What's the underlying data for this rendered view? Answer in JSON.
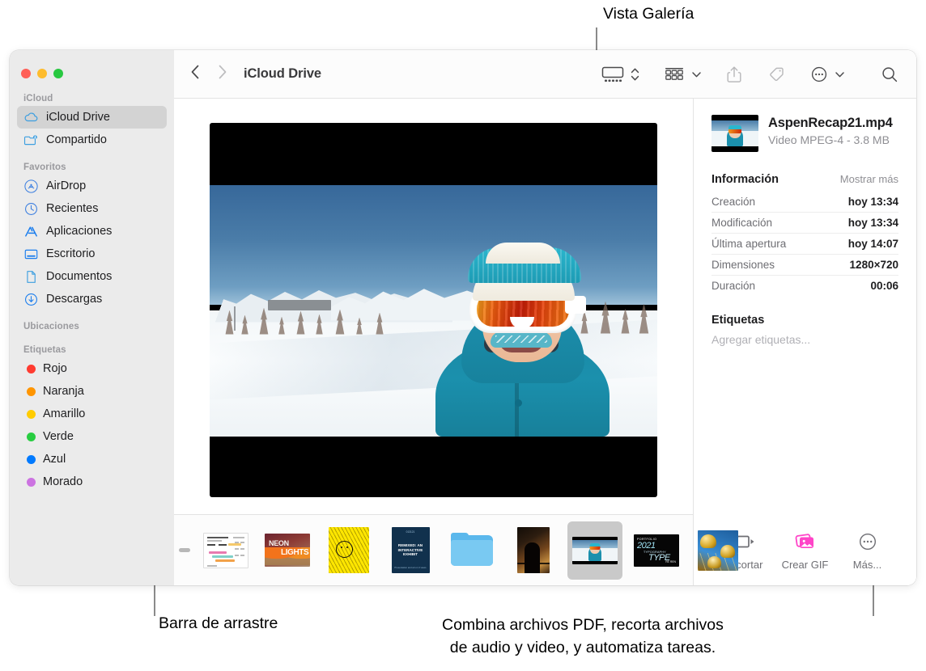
{
  "window": {
    "traffic_lights": [
      {
        "name": "close",
        "color": "#ff5f57"
      },
      {
        "name": "minimize",
        "color": "#febc2e"
      },
      {
        "name": "zoom",
        "color": "#28c840"
      }
    ]
  },
  "toolbar": {
    "back_label": "‹",
    "forward_label": "›",
    "path_title": "iCloud Drive",
    "buttons": [
      {
        "name": "gallery-view",
        "icon": "gallery-view-icon"
      },
      {
        "name": "view-options-stepper",
        "icon": "chevron-updown-icon"
      },
      {
        "name": "group-by",
        "icon": "grid-group-icon"
      },
      {
        "name": "group-by-chevron",
        "icon": "chevron-down-icon"
      },
      {
        "name": "share",
        "icon": "share-icon"
      },
      {
        "name": "tags",
        "icon": "tag-icon"
      },
      {
        "name": "more-actions",
        "icon": "ellipsis-circle-icon"
      },
      {
        "name": "more-actions-chevron",
        "icon": "chevron-down-icon"
      },
      {
        "name": "search",
        "icon": "search-icon"
      }
    ]
  },
  "sidebar": {
    "groups": [
      {
        "title": "iCloud",
        "items": [
          {
            "label": "iCloud Drive",
            "icon": "cloud-icon",
            "selected": true
          },
          {
            "label": "Compartido",
            "icon": "shared-folder-icon",
            "selected": false
          }
        ]
      },
      {
        "title": "Favoritos",
        "items": [
          {
            "label": "AirDrop",
            "icon": "airdrop-icon",
            "selected": false
          },
          {
            "label": "Recientes",
            "icon": "clock-icon",
            "selected": false
          },
          {
            "label": "Aplicaciones",
            "icon": "applications-icon",
            "selected": false
          },
          {
            "label": "Escritorio",
            "icon": "desktop-icon",
            "selected": false
          },
          {
            "label": "Documentos",
            "icon": "document-icon",
            "selected": false
          },
          {
            "label": "Descargas",
            "icon": "downloads-icon",
            "selected": false
          }
        ]
      },
      {
        "title": "Ubicaciones",
        "items": []
      },
      {
        "title": "Etiquetas",
        "items": [
          {
            "label": "Rojo",
            "color": "#ff3b30",
            "selected": false
          },
          {
            "label": "Naranja",
            "color": "#ff9500",
            "selected": false
          },
          {
            "label": "Amarillo",
            "color": "#ffcc00",
            "selected": false
          },
          {
            "label": "Verde",
            "color": "#28cd41",
            "selected": false
          },
          {
            "label": "Azul",
            "color": "#007aff",
            "selected": false
          },
          {
            "label": "Morado",
            "color": "#cc73e1",
            "selected": false
          }
        ]
      }
    ]
  },
  "preview": {
    "name": "video-preview",
    "description": "Snowboarder with white goggles and teal beanie in snowy mountains, letterboxed video"
  },
  "filmstrip": {
    "drag_bar_label": "drag-bar",
    "thumbnails": [
      {
        "name": "thumb-chart-document",
        "type": "document",
        "selected": false
      },
      {
        "name": "thumb-neon-lights-poster",
        "type": "poster",
        "text1": "NEON",
        "text2": "LIGHTS",
        "selected": false
      },
      {
        "name": "thumb-thank-you-poster",
        "type": "poster",
        "selected": false
      },
      {
        "name": "thumb-exhibit-poster",
        "type": "poster",
        "title": "013121",
        "body": "REMIXED:\nAN INTERACTIVE\nEXHIBIT",
        "footer": "Presentation and art on 3 views",
        "selected": false
      },
      {
        "name": "thumb-folder",
        "type": "folder",
        "selected": false
      },
      {
        "name": "thumb-silhouette-photo",
        "type": "photo",
        "selected": false
      },
      {
        "name": "thumb-aspen-recap-video",
        "type": "video",
        "selected": true
      },
      {
        "name": "thumb-typography-poster",
        "type": "poster",
        "p1": "PORTFOLIO",
        "p2": "2021",
        "p3": "TYPOGRAPHY",
        "p4": "TYPE",
        "p5": "RE REN",
        "selected": false
      },
      {
        "name": "thumb-gold-balloons-photo",
        "type": "photo",
        "selected": false
      }
    ]
  },
  "info_panel": {
    "file_name": "AspenRecap21.mp4",
    "file_subtitle": "Video MPEG-4 - 3.8 MB",
    "section_title": "Información",
    "show_more": "Mostrar más",
    "rows": [
      {
        "key": "Creación",
        "value": "hoy 13:34"
      },
      {
        "key": "Modificación",
        "value": "hoy 13:34"
      },
      {
        "key": "Última apertura",
        "value": "hoy 14:07"
      },
      {
        "key": "Dimensiones",
        "value": "1280×720"
      },
      {
        "key": "Duración",
        "value": "00:06"
      }
    ],
    "tags_title": "Etiquetas",
    "tags_placeholder": "Agregar etiquetas...",
    "actions": [
      {
        "label": "Recortar",
        "icon": "trim-video-icon",
        "color": "#6e6e73"
      },
      {
        "label": "Crear GIF",
        "icon": "create-gif-icon",
        "color": "#ff44c8"
      },
      {
        "label": "Más...",
        "icon": "ellipsis-circle-icon",
        "color": "#6e6e73"
      }
    ]
  },
  "callouts": [
    {
      "name": "callout-gallery-view",
      "text": "Vista Galería"
    },
    {
      "name": "callout-drag-bar",
      "text": "Barra de arrastre"
    },
    {
      "name": "callout-quick-actions",
      "line1": "Combina archivos PDF, recorta archivos",
      "line2": "de audio y video, y automatiza tareas."
    }
  ]
}
